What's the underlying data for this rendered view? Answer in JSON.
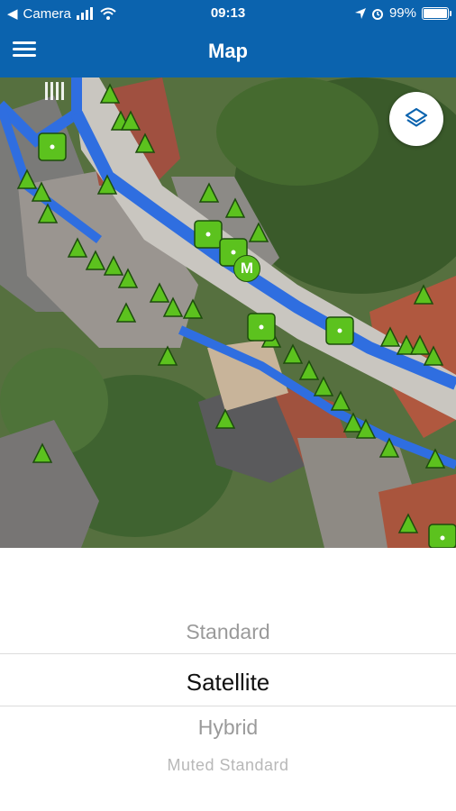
{
  "status_bar": {
    "carrier": "Camera",
    "time": "09:13",
    "battery": "99%"
  },
  "nav": {
    "title": "Map",
    "menu_icon": "hamburger-icon"
  },
  "map": {
    "layers_icon": "layers-icon",
    "meter_marker_label": "M",
    "colors": {
      "route": "#2f6ee0",
      "marker_fill": "#5cc21e",
      "marker_border": "#1d4d0c"
    }
  },
  "map_type_picker": {
    "options": [
      "Standard",
      "Satellite",
      "Hybrid",
      "Muted Standard"
    ],
    "selected": "Satellite"
  }
}
